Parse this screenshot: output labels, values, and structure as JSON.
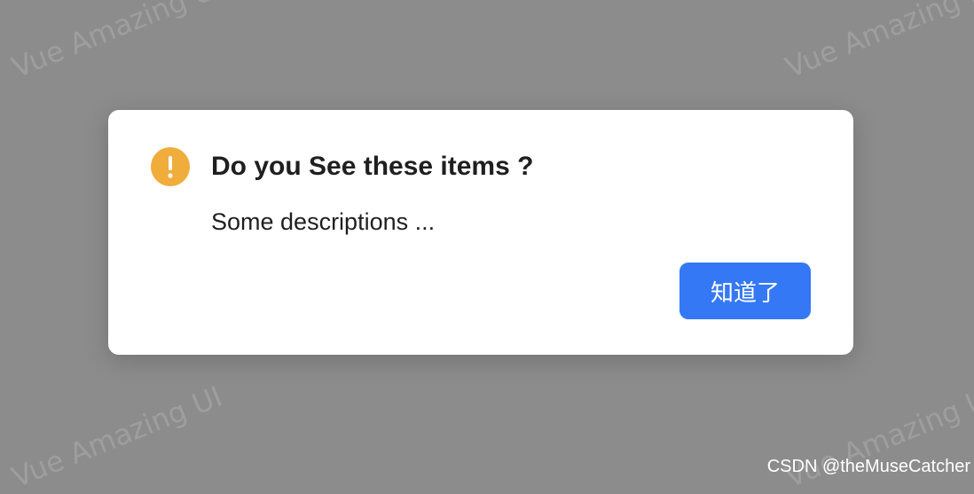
{
  "watermark": {
    "text": "Vue Amazing UI"
  },
  "dialog": {
    "icon": "exclamation-icon",
    "title": "Do you See these items ?",
    "description": "Some descriptions ...",
    "ok_label": "知道了"
  },
  "credit": {
    "text": "CSDN @theMuseCatcher"
  },
  "colors": {
    "overlay": "#8c8c8c",
    "warning": "#f0ad3c",
    "primary": "#3478f6",
    "text": "#1f1f1f"
  }
}
